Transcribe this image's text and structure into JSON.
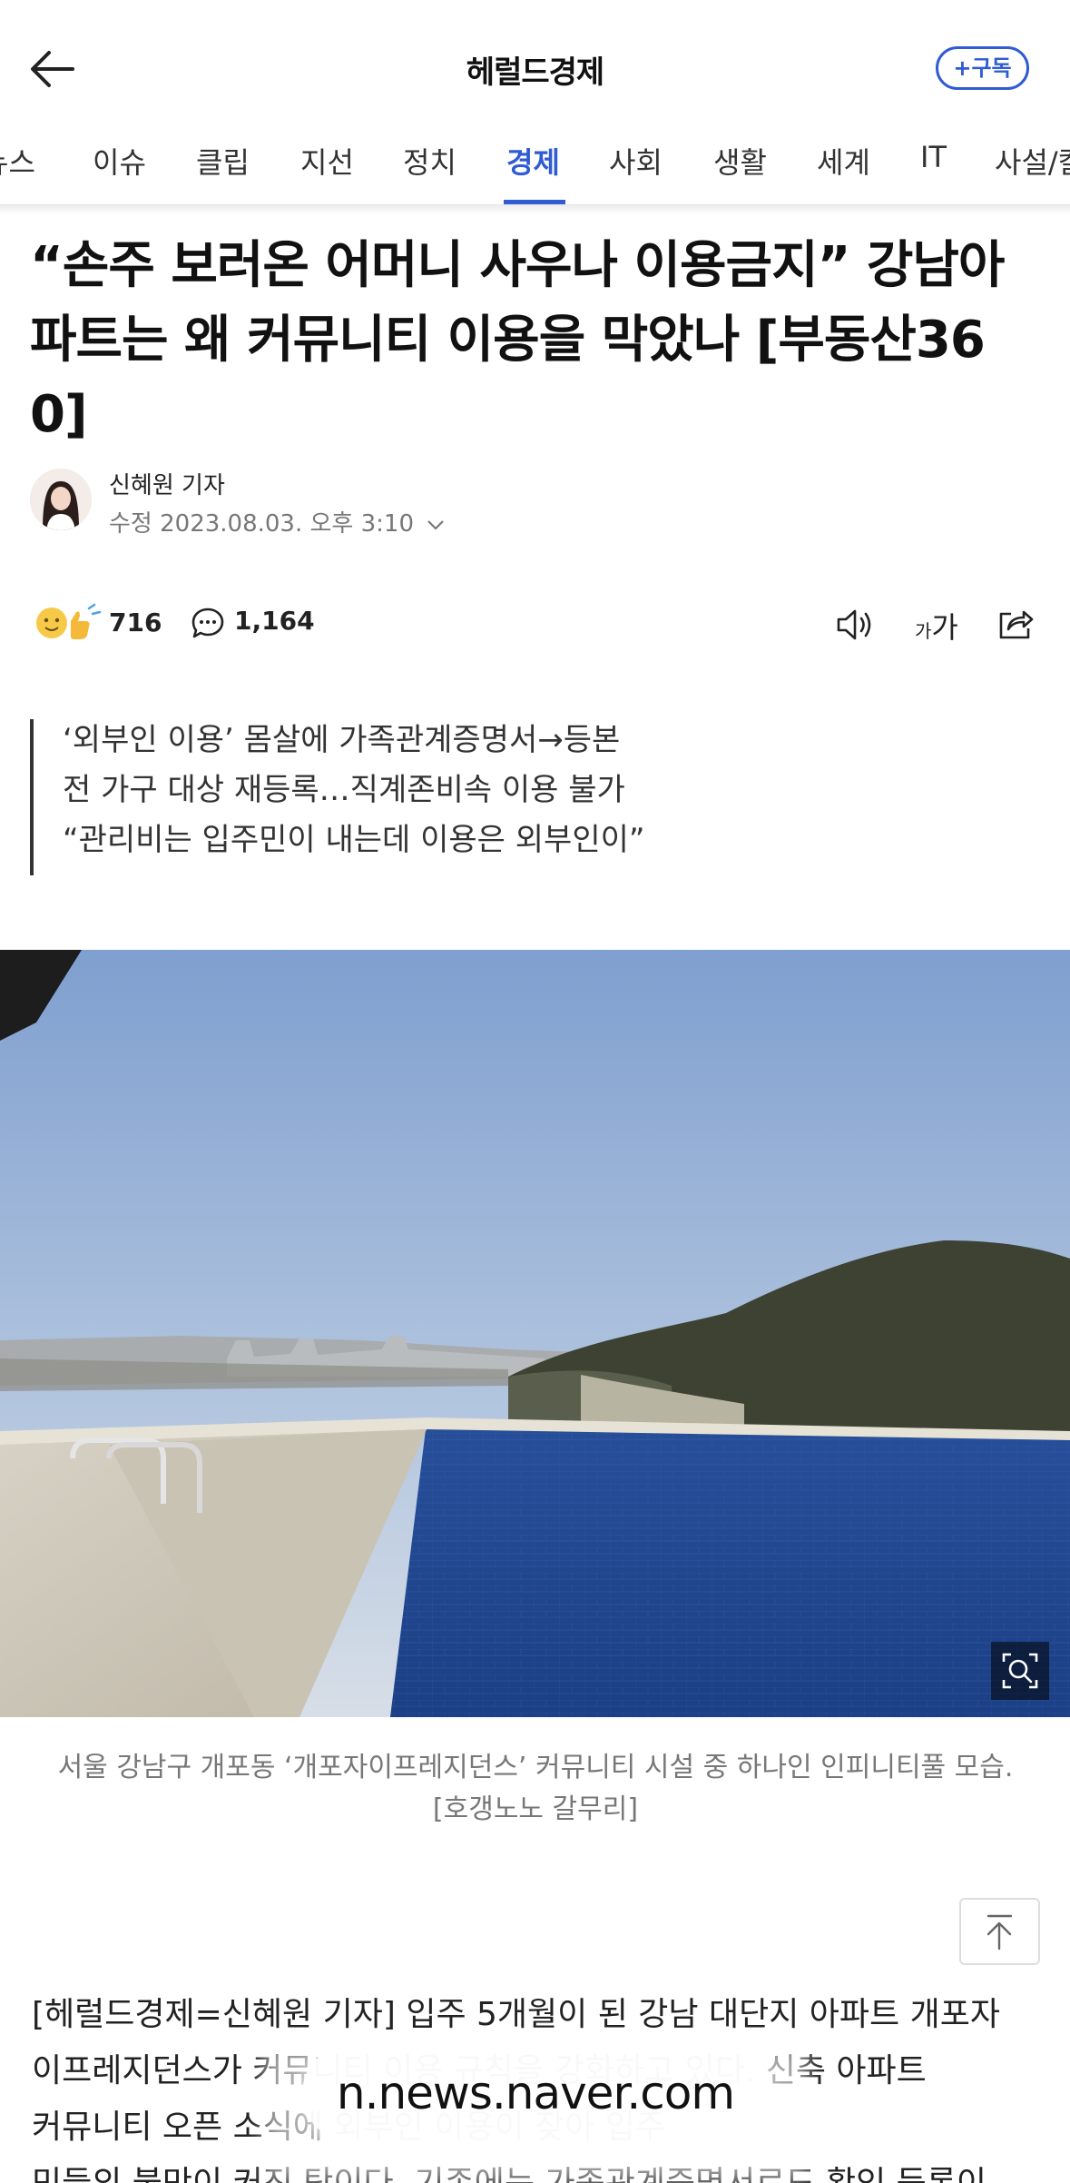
{
  "header": {
    "brand": "헤럴드경제",
    "subscribe_label": "+구독"
  },
  "tabs": [
    {
      "label": "뉴스"
    },
    {
      "label": "이슈"
    },
    {
      "label": "클립"
    },
    {
      "label": "지선"
    },
    {
      "label": "정치"
    },
    {
      "label": "경제",
      "active": true
    },
    {
      "label": "사회"
    },
    {
      "label": "생활"
    },
    {
      "label": "세계"
    },
    {
      "label": "IT"
    },
    {
      "label": "사설/칼럼"
    }
  ],
  "article": {
    "title_line1": "“손주 보러온 어머니 사우나 이용금지” 강남아",
    "title_line2": "파트는 왜 커뮤니티 이용을 막았나 [부동산36",
    "title_line3": "0]",
    "author": "신혜원 기자",
    "dateline": "수정 2023.08.03. 오후 3:10",
    "reaction_count": "716",
    "comment_count": "1,164",
    "font_label_small": "가",
    "font_label_large": "가",
    "summary": [
      "‘외부인 이용’ 몸살에 가족관계증명서→등본",
      "전 가구 대상 재등록…직계존비속 이용 불가",
      "“관리비는 입주민이 내는데 이용은 외부인이”"
    ],
    "caption_line1": "서울 강남구 개포동 ‘개포자이프레지던스’ 커뮤니티 시설 중 하나인 인피니티풀 모습.",
    "caption_line2": "[호갱노노 갈무리]",
    "body_line1": "[헤럴드경제=신혜원 기자] 입주 5개월이 된 강남 대단지 아파트 개포자",
    "body_line2": "이프레지던스가 커뮤니티 이용 규칙을 강화하고 있다. 신축 아파트",
    "body_line3": "커뮤니티 오픈 소식에 외부인 이용이 잦아 입주",
    "body_line4": "민들의 불만이 커진 탓이다. 기존에는 가족관계증명서로도 확인 등록이"
  },
  "browser": {
    "url": "n.news.naver.com"
  },
  "icons": {
    "back": "arrow-left-icon",
    "comment": "speech-bubble-icon",
    "sound": "speaker-icon",
    "share": "share-icon",
    "zoom": "image-zoom-icon",
    "top": "arrow-up-icon"
  },
  "colors": {
    "accent": "#2f5bd3"
  }
}
